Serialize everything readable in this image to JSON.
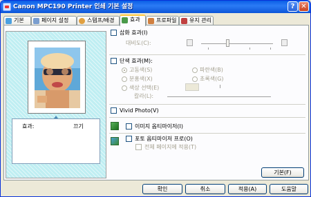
{
  "window": {
    "title": "Canon MPC190 Printer 인쇄 기본 설정"
  },
  "tabs": [
    {
      "label": "기본"
    },
    {
      "label": "페이지 설정"
    },
    {
      "label": "스탬프/배경"
    },
    {
      "label": "효과"
    },
    {
      "label": "프로파일"
    },
    {
      "label": "유지 관리"
    }
  ],
  "preview": {
    "effect_label": "효과:",
    "effect_value": "끄기"
  },
  "effects": {
    "illustration": {
      "label": "삽화 효과(I)",
      "checked": false
    },
    "contrast_label": "대비도(C):",
    "monochrome": {
      "label": "단색 효과(M):",
      "checked": false
    },
    "mono_options": [
      {
        "label": "고동색(S)",
        "selected": true
      },
      {
        "label": "파란색(B)",
        "selected": false
      },
      {
        "label": "분홍색(X)",
        "selected": false
      },
      {
        "label": "초록색(G)",
        "selected": false
      },
      {
        "label": "색상 선택(E)",
        "selected": false
      }
    ],
    "color_label": "칼라(L):",
    "vivid_photo": {
      "label": "Vivid Photo(V)",
      "checked": false
    },
    "image_optimizer": {
      "label": "이미지 옵티마이저(I)",
      "checked": false
    },
    "photo_optimizer_pro": {
      "label": "포토 옵티마이저 프로(O)",
      "checked": false
    },
    "apply_all_pages": {
      "label": "전체 페이지에 적용(T)",
      "checked": false
    }
  },
  "buttons": {
    "defaults": "기본(F)",
    "ok": "확인",
    "cancel": "취소",
    "apply": "적용(A)",
    "help": "도움말"
  },
  "colors": {
    "title_bar": "#0a5ee6",
    "active_tab_highlight": "#ffc73c",
    "preview_background": "#bfeef2",
    "panel_background": "#fcfcfe",
    "dialog_background": "#ece9d8"
  }
}
